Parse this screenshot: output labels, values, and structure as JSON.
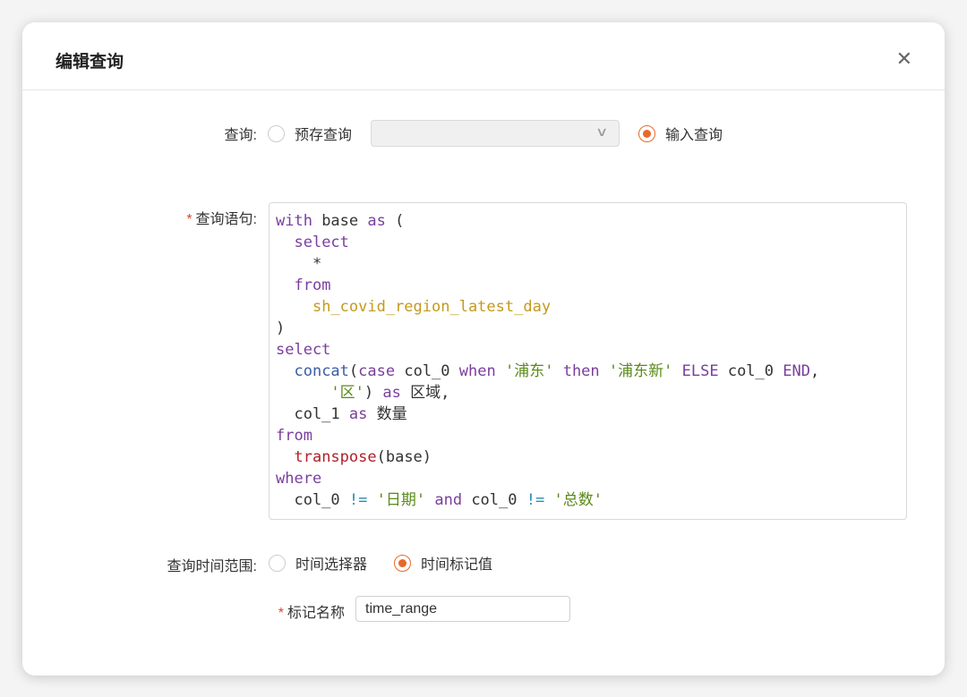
{
  "dialog": {
    "title": "编辑查询",
    "close_icon": "close-icon"
  },
  "query": {
    "label": "查询:",
    "option_saved": "预存查询",
    "saved_select_value": "",
    "option_input": "输入查询",
    "selected": "输入查询"
  },
  "statement": {
    "label": "查询语句:",
    "required": "*",
    "lines": [
      [
        [
          "kw",
          "with"
        ],
        [
          "tx",
          " base "
        ],
        [
          "kw",
          "as"
        ],
        [
          "tx",
          " ("
        ]
      ],
      [
        [
          "tx",
          "  "
        ],
        [
          "kw",
          "select"
        ]
      ],
      [
        [
          "tx",
          "    *"
        ]
      ],
      [
        [
          "tx",
          "  "
        ],
        [
          "kw",
          "from"
        ]
      ],
      [
        [
          "tx",
          "    "
        ],
        [
          "tb",
          "sh_covid_region_latest_day"
        ]
      ],
      [
        [
          "tx",
          ")"
        ]
      ],
      [
        [
          "kw",
          "select"
        ]
      ],
      [
        [
          "tx",
          "  "
        ],
        [
          "fn",
          "concat"
        ],
        [
          "tx",
          "("
        ],
        [
          "kw",
          "case"
        ],
        [
          "tx",
          " col_0 "
        ],
        [
          "kw",
          "when"
        ],
        [
          "tx",
          " "
        ],
        [
          "st",
          "'浦东'"
        ],
        [
          "tx",
          " "
        ],
        [
          "kw",
          "then"
        ],
        [
          "tx",
          " "
        ],
        [
          "st",
          "'浦东新'"
        ],
        [
          "tx",
          " "
        ],
        [
          "kw",
          "ELSE"
        ],
        [
          "tx",
          " col_0 "
        ],
        [
          "kw",
          "END"
        ],
        [
          "tx",
          ","
        ]
      ],
      [
        [
          "tx",
          "      "
        ],
        [
          "st",
          "'区'"
        ],
        [
          "tx",
          ") "
        ],
        [
          "kw",
          "as"
        ],
        [
          "tx",
          " 区域,"
        ]
      ],
      [
        [
          "tx",
          "  col_1 "
        ],
        [
          "kw",
          "as"
        ],
        [
          "tx",
          " 数量"
        ]
      ],
      [
        [
          "kw",
          "from"
        ]
      ],
      [
        [
          "tx",
          "  "
        ],
        [
          "rd",
          "transpose"
        ],
        [
          "tx",
          "(base)"
        ]
      ],
      [
        [
          "kw",
          "where"
        ]
      ],
      [
        [
          "tx",
          "  col_0 "
        ],
        [
          "op",
          "!="
        ],
        [
          "tx",
          " "
        ],
        [
          "st",
          "'日期'"
        ],
        [
          "tx",
          " "
        ],
        [
          "kw",
          "and"
        ],
        [
          "tx",
          " col_0 "
        ],
        [
          "op",
          "!="
        ],
        [
          "tx",
          " "
        ],
        [
          "st",
          "'总数'"
        ]
      ]
    ]
  },
  "time_range": {
    "label": "查询时间范围:",
    "option_picker": "时间选择器",
    "option_marker": "时间标记值",
    "selected": "时间标记值"
  },
  "marker_name": {
    "label": "标记名称",
    "required": "*",
    "value": "time_range"
  },
  "colors": {
    "accent": "#e8682a",
    "keyword": "#7a3e9d",
    "table": "#c49a1b",
    "function": "#3a5ca8",
    "string": "#5a8a1a"
  }
}
